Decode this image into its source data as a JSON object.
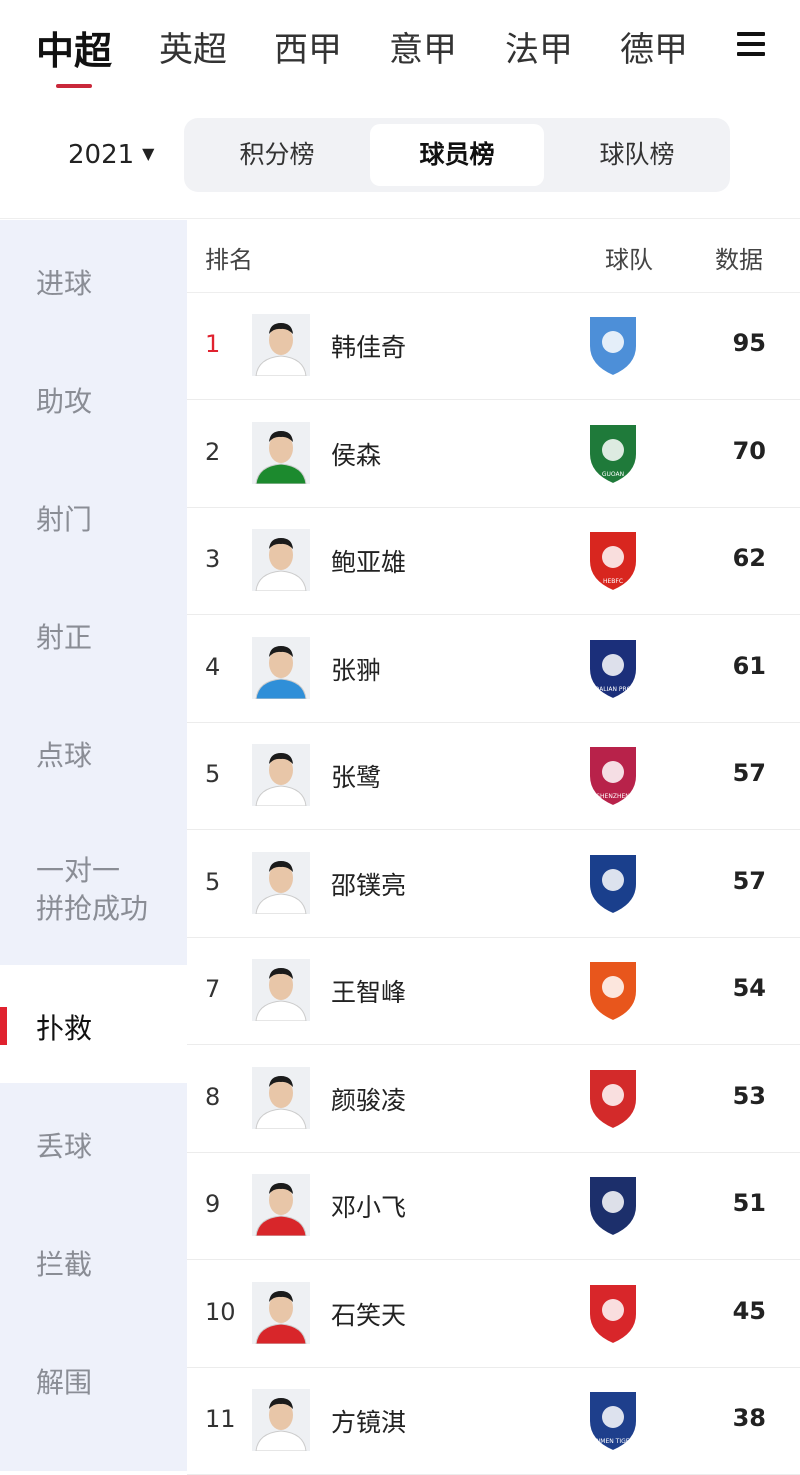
{
  "leagues": [
    "中超",
    "英超",
    "西甲",
    "意甲",
    "法甲",
    "德甲"
  ],
  "season": "2021",
  "segments": [
    "积分榜",
    "球员榜",
    "球队榜"
  ],
  "sidebar": [
    "进球",
    "助攻",
    "射门",
    "射正",
    "点球",
    "一对一\n拼抢成功",
    "扑救",
    "丢球",
    "拦截",
    "解围"
  ],
  "table": {
    "headers": {
      "rank": "排名",
      "team": "球队",
      "value": "数据"
    },
    "rows": [
      {
        "rank": "1",
        "name": "韩佳奇",
        "value": "95",
        "jersey": "#ffffff",
        "badge_color": "#4d8fd8",
        "badge_text": ""
      },
      {
        "rank": "2",
        "name": "侯森",
        "value": "70",
        "jersey": "#1c8a2e",
        "badge_color": "#1f7a3a",
        "badge_text": "GUOAN"
      },
      {
        "rank": "3",
        "name": "鲍亚雄",
        "value": "62",
        "jersey": "#ffffff",
        "badge_color": "#d8261f",
        "badge_text": "HEBFC"
      },
      {
        "rank": "4",
        "name": "张翀",
        "value": "61",
        "jersey": "#2f8fd8",
        "badge_color": "#1b2f7a",
        "badge_text": "DALIAN PRO"
      },
      {
        "rank": "5",
        "name": "张鹭",
        "value": "57",
        "jersey": "#ffffff",
        "badge_color": "#b8224a",
        "badge_text": "SHENZHEN"
      },
      {
        "rank": "5",
        "name": "邵镤亮",
        "value": "57",
        "jersey": "#ffffff",
        "badge_color": "#1a3f8c",
        "badge_text": ""
      },
      {
        "rank": "7",
        "name": "王智峰",
        "value": "54",
        "jersey": "#ffffff",
        "badge_color": "#e8561c",
        "badge_text": ""
      },
      {
        "rank": "8",
        "name": "颜骏凌",
        "value": "53",
        "jersey": "#ffffff",
        "badge_color": "#d32a2a",
        "badge_text": ""
      },
      {
        "rank": "9",
        "name": "邓小飞",
        "value": "51",
        "jersey": "#d8262a",
        "badge_color": "#1c2f6b",
        "badge_text": ""
      },
      {
        "rank": "10",
        "name": "石笑天",
        "value": "45",
        "jersey": "#d8262a",
        "badge_color": "#d8262a",
        "badge_text": ""
      },
      {
        "rank": "11",
        "name": "方镜淇",
        "value": "38",
        "jersey": "#ffffff",
        "badge_color": "#1e3f8c",
        "badge_text": "JINMEN TIGER"
      }
    ]
  }
}
